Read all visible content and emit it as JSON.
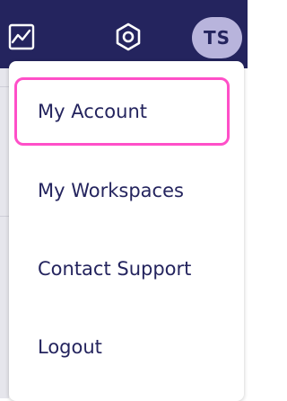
{
  "topbar": {
    "icons": [
      "activity-chart-icon",
      "settings-hexagon-icon"
    ],
    "avatar_initials": "TS"
  },
  "menu": {
    "items": [
      {
        "label": "My Account",
        "focused": true
      },
      {
        "label": "My Workspaces"
      },
      {
        "label": "Contact Support"
      },
      {
        "label": "Logout"
      }
    ]
  },
  "colors": {
    "topbar_bg": "#24245e",
    "avatar_bg": "#b8b4dc",
    "focus_ring": "#ff4fc8",
    "menu_text": "#24245e"
  }
}
